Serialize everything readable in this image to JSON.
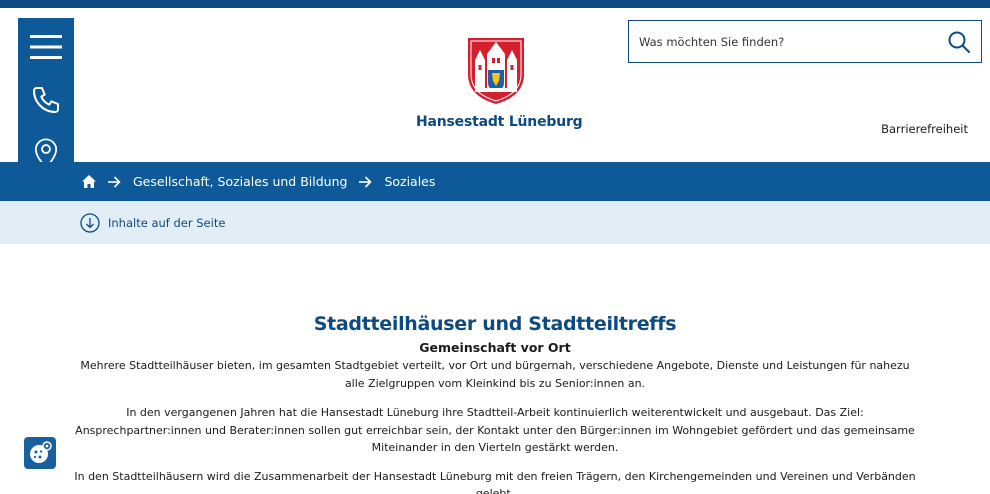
{
  "header": {
    "site_name": "Hansestadt Lüneburg",
    "search_placeholder": "Was möchten Sie finden?",
    "accessibility_link": "Barrierefreiheit"
  },
  "breadcrumb": {
    "items": [
      "Gesellschaft, Soziales und Bildung",
      "Soziales"
    ]
  },
  "toc": {
    "label": "Inhalte auf der Seite"
  },
  "main": {
    "title": "Stadtteilhäuser und Stadtteiltreffs",
    "subtitle": "Gemeinschaft vor Ort",
    "paragraphs": [
      "Mehrere Stadtteilhäuser bieten, im gesamten Stadtgebiet verteilt, vor Ort und bürgernah, verschiedene Angebote, Dienste und Leistungen für nahezu alle Zielgruppen vom Kleinkind bis zu Senior:innen an.",
      "In den vergangenen Jahren hat die Hansestadt Lüneburg ihre Stadtteil-Arbeit kontinuierlich weiterentwickelt und ausgebaut. Das Ziel: Ansprechpartner:innen und Berater:innen sollen gut erreichbar sein, der Kontakt unter den Bürger:innen im Wohngebiet gefördert und das gemeinsame Miteinander in den Vierteln gestärkt werden.",
      "In den Stadtteilhäusern wird die Zusammenarbeit der Hansestadt Lüneburg mit den freien Trägern, den Kirchengemeinden und Vereinen und Verbänden gelebt."
    ]
  },
  "icons": {
    "menu": "hamburger-menu-icon",
    "phone": "phone-icon",
    "location": "map-pin-icon",
    "search": "search-icon",
    "home": "home-icon",
    "arrow": "arrow-right-icon",
    "toc": "arrow-down-circle-icon",
    "cookie": "cookie-settings-icon"
  },
  "colors": {
    "primary": "#0e5a98",
    "primary_dark": "#0d4a80",
    "toc_bg": "#e3edf5",
    "crest_red": "#d3202e"
  }
}
